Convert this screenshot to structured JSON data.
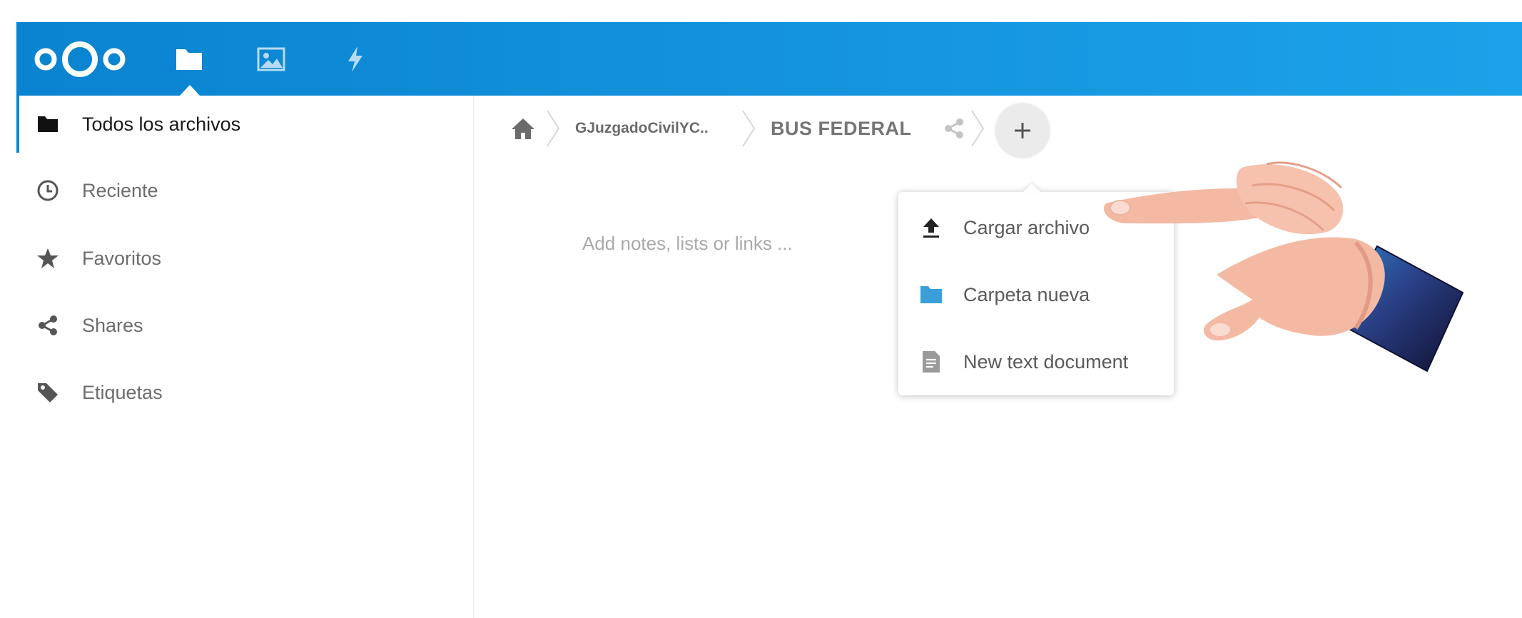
{
  "header": {
    "apps": [
      {
        "name": "files",
        "icon": "folder-icon"
      },
      {
        "name": "gallery",
        "icon": "image-icon"
      },
      {
        "name": "activity",
        "icon": "lightning-icon"
      }
    ],
    "logo": "nextcloud-logo",
    "colors": {
      "start": "#0a83d0",
      "end": "#1ca2e8"
    }
  },
  "sidebar": {
    "items": [
      {
        "label": "Todos los archivos",
        "icon": "folder-icon",
        "active": true
      },
      {
        "label": "Reciente",
        "icon": "clock-icon",
        "active": false
      },
      {
        "label": "Favoritos",
        "icon": "star-icon",
        "active": false
      },
      {
        "label": "Shares",
        "icon": "share-icon",
        "active": false
      },
      {
        "label": "Etiquetas",
        "icon": "tag-icon",
        "active": false
      }
    ]
  },
  "breadcrumb": {
    "home_icon": "home-icon",
    "items": [
      {
        "label": "GJuzgadoCivilYC.."
      },
      {
        "label": "BUS FEDERAL"
      }
    ],
    "share_icon": "share-icon"
  },
  "add_button": {
    "label": "+"
  },
  "notes": {
    "placeholder": "Add notes, lists or links ..."
  },
  "new_menu": {
    "items": [
      {
        "label": "Cargar archivo",
        "icon": "upload-icon"
      },
      {
        "label": "Carpeta nueva",
        "icon": "folder-icon"
      },
      {
        "label": "New text document",
        "icon": "text-document-icon"
      }
    ]
  },
  "overlay": {
    "icon": "pointing-hand-icon"
  }
}
